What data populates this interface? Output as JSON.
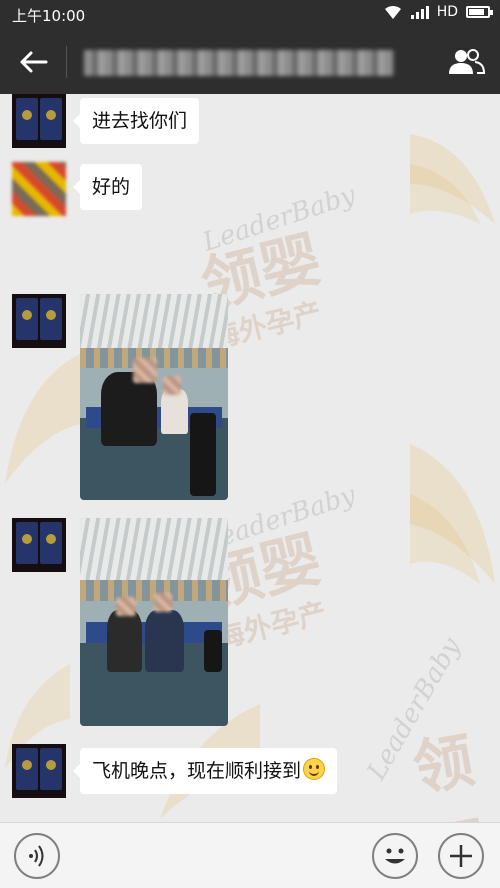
{
  "status_bar": {
    "time": "上午10:00",
    "network": "HD",
    "battery_level": 0.85
  },
  "navbar": {
    "title": "",
    "back_icon": "arrow-left-icon",
    "group_icon": "people-icon"
  },
  "messages": [
    {
      "type": "text",
      "text": "进去找你们"
    },
    {
      "type": "text",
      "text": "好的"
    },
    {
      "type": "image",
      "description": ""
    },
    {
      "type": "image",
      "description": ""
    },
    {
      "type": "text",
      "text": "飞机晚点，现在顺利接到",
      "emoji": "smile-emoji"
    }
  ],
  "watermark": {
    "latin": "LeaderBaby",
    "chinese_big": "领婴",
    "chinese_small": "海外孕产"
  },
  "input_bar": {
    "voice_icon": "voice-icon",
    "emoji_icon": "emoji-icon",
    "plus_icon": "plus-icon"
  },
  "colors": {
    "bar": "#2e2e2e",
    "chat_bg": "#ebebeb",
    "bubble": "#ffffff"
  }
}
